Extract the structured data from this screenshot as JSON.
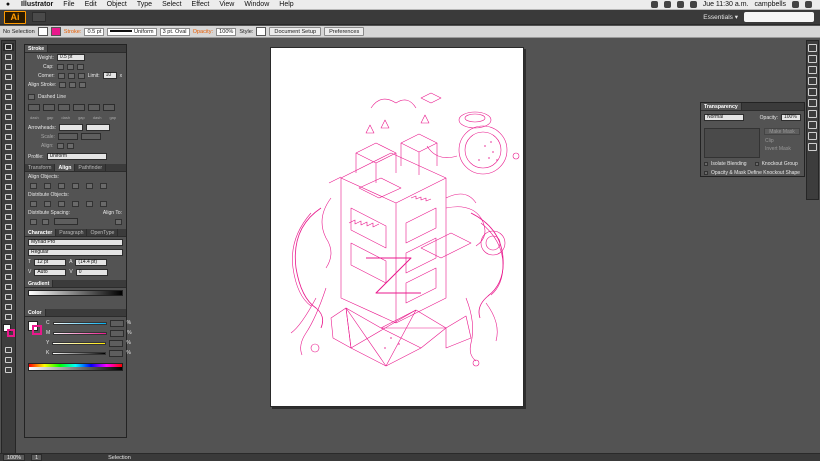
{
  "menubar": {
    "app_name": "Illustrator",
    "menus": [
      "File",
      "Edit",
      "Object",
      "Type",
      "Select",
      "Effect",
      "View",
      "Window",
      "Help"
    ],
    "clock": "Jue 11:30 a.m.",
    "user": "campbells"
  },
  "appbar": {
    "logo": "Ai",
    "workspace": "Essentials ▾"
  },
  "control": {
    "selection": "No Selection",
    "stroke_label": "Stroke:",
    "stroke_weight": "0.5 pt",
    "profile": "Uniform",
    "brush": "3 pt. Oval",
    "opacity_label": "Opacity:",
    "opacity": "100%",
    "style_label": "Style:",
    "doc_setup": "Document Setup",
    "preferences": "Preferences"
  },
  "stroke_panel": {
    "title": "Stroke",
    "weight_label": "Weight:",
    "weight": "0.5 pt",
    "cap_label": "Cap:",
    "corner_label": "Corner:",
    "limit_label": "Limit:",
    "limit": "10",
    "limit_unit": "x",
    "align_label": "Align Stroke:",
    "dashed": "Dashed Line",
    "dash_labels": [
      "dash",
      "gap",
      "dash",
      "gap",
      "dash",
      "gap"
    ],
    "arrowheads_label": "Arrowheads:",
    "scale_label": "Scale:",
    "align2_label": "Align:",
    "profile_label": "Profile:",
    "profile": "Uniform"
  },
  "align_panel": {
    "tabs": [
      "Transform",
      "Align",
      "Pathfinder"
    ],
    "objects_label": "Align Objects:",
    "distribute_label": "Distribute Objects:",
    "spacing_label": "Distribute Spacing:",
    "align_to_label": "Align To:"
  },
  "character_panel": {
    "tabs": [
      "Character",
      "Paragraph",
      "OpenType"
    ],
    "font": "Myriad Pro",
    "style": "Regular",
    "size": "12 pt",
    "leading": "(14.4 pt)",
    "kerning": "Auto",
    "tracking": "0"
  },
  "gradient_panel": {
    "title": "Gradient"
  },
  "color_panel": {
    "title": "Color",
    "channels": [
      {
        "label": "C",
        "unit": "%"
      },
      {
        "label": "M",
        "unit": "%"
      },
      {
        "label": "Y",
        "unit": "%"
      },
      {
        "label": "K",
        "unit": "%"
      }
    ]
  },
  "transparency_panel": {
    "title": "Transparency",
    "mode": "Normal",
    "opacity_label": "Opacity:",
    "opacity": "100%",
    "make_mask": "Make Mask",
    "clip": "Clip",
    "invert": "Invert Mask",
    "isolate": "Isolate Blending",
    "knockout": "Knockout Group",
    "opacity_mask": "Opacity & Mask Define Knockout Shape"
  },
  "status": {
    "zoom": "100%",
    "artboard": "1",
    "tool": "Selection"
  },
  "colors": {
    "illustration": "#e9188c",
    "ai_orange": "#ff9a00",
    "panel": "#535353",
    "pasteboard": "#535353"
  },
  "icons": [
    "apple-icon",
    "wifi-icon",
    "battery-icon",
    "search-icon",
    "selection-tool-icon",
    "direct-select-icon",
    "pen-icon",
    "type-icon",
    "rectangle-icon",
    "brush-icon",
    "rotate-icon",
    "scale-icon",
    "gradient-icon",
    "hand-icon",
    "zoom-icon"
  ]
}
